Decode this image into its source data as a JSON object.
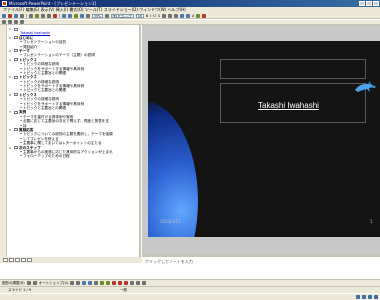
{
  "window": {
    "title": "Microsoft PowerPoint - [プレゼンテーション1]",
    "menu": "ファイル(F)  編集(E)  表示(V)  挿入(I)  書式(O)  ツール(T)  スライドショー(D)  ウィンドウ(W)  ヘルプ(H)"
  },
  "toolbar": {
    "zoom": "33%",
    "font_name": "MS Pゴシック",
    "font_size": "18"
  },
  "outline": {
    "rows": [
      {
        "type": "slide",
        "num": "1",
        "text": ""
      },
      {
        "type": "title_link",
        "text": "Takashi Iwahashi"
      },
      {
        "type": "slide",
        "num": "2",
        "text": "はじめに"
      },
      {
        "type": "bullet",
        "text": "プレゼンテーションの目的"
      },
      {
        "type": "bullet",
        "text": "発話紹介"
      },
      {
        "type": "slide",
        "num": "3",
        "text": "テーマ"
      },
      {
        "type": "bullet",
        "text": "プレゼンテーションのテーマ（主題）の説明"
      },
      {
        "type": "slide",
        "num": "4",
        "text": "トピック１"
      },
      {
        "type": "bullet",
        "text": "トピックの詳細な説明"
      },
      {
        "type": "bullet",
        "text": "トピックをサポートする情報や具体例"
      },
      {
        "type": "bullet",
        "text": "トピックと主要旨との関連"
      },
      {
        "type": "slide",
        "num": "5",
        "text": "トピック２"
      },
      {
        "type": "bullet",
        "text": "トピックの詳細な説明"
      },
      {
        "type": "bullet",
        "text": "トピックをサポートする情報や具体例"
      },
      {
        "type": "bullet",
        "text": "トピックと主要旨との関連"
      },
      {
        "type": "slide",
        "num": "6",
        "text": "トピック３"
      },
      {
        "type": "bullet",
        "text": "トピックの詳細な説明"
      },
      {
        "type": "bullet",
        "text": "トピックをサポートする情報や具体例"
      },
      {
        "type": "bullet",
        "text": "トピックと主要旨との関連"
      },
      {
        "type": "slide",
        "num": "7",
        "text": "実例"
      },
      {
        "type": "bullet",
        "text": "テーマを裏付ける具体例や実例"
      },
      {
        "type": "bullet",
        "text": "必要に応じて主要旨の次元で問えず、再度と発表を支"
      },
      {
        "type": "bullet",
        "text": "持"
      },
      {
        "type": "slide",
        "num": "8",
        "text": "質疑応答"
      },
      {
        "type": "bullet",
        "text": "トピックについての総別の主題を要約し、テーマを強調"
      },
      {
        "type": "bullet",
        "text": "してプレゼンを終える"
      },
      {
        "type": "bullet",
        "text": "主要事に関してまいてはレターポイントの主たる"
      },
      {
        "type": "slide",
        "num": "9",
        "text": "次のステップ"
      },
      {
        "type": "bullet",
        "text": "主要事からの実施に応じた具体的なアクションが上まれ"
      },
      {
        "type": "bullet",
        "text": "フォローアップのための日程"
      }
    ]
  },
  "slide": {
    "title": "Takashi Iwahashi",
    "date": "2003/4/12",
    "number": "1"
  },
  "notes": {
    "placeholder": "クリックしてノートを入力"
  },
  "drawbar": {
    "draw_label": "図形の調整(R)",
    "autoshape_label": "オートシェイプ(U)"
  },
  "status": {
    "slide_info": "スライド 1 / 9",
    "design": "一般"
  },
  "colors": {
    "slide_bg": "#141414",
    "accent_blue": "#2a5fd0"
  }
}
